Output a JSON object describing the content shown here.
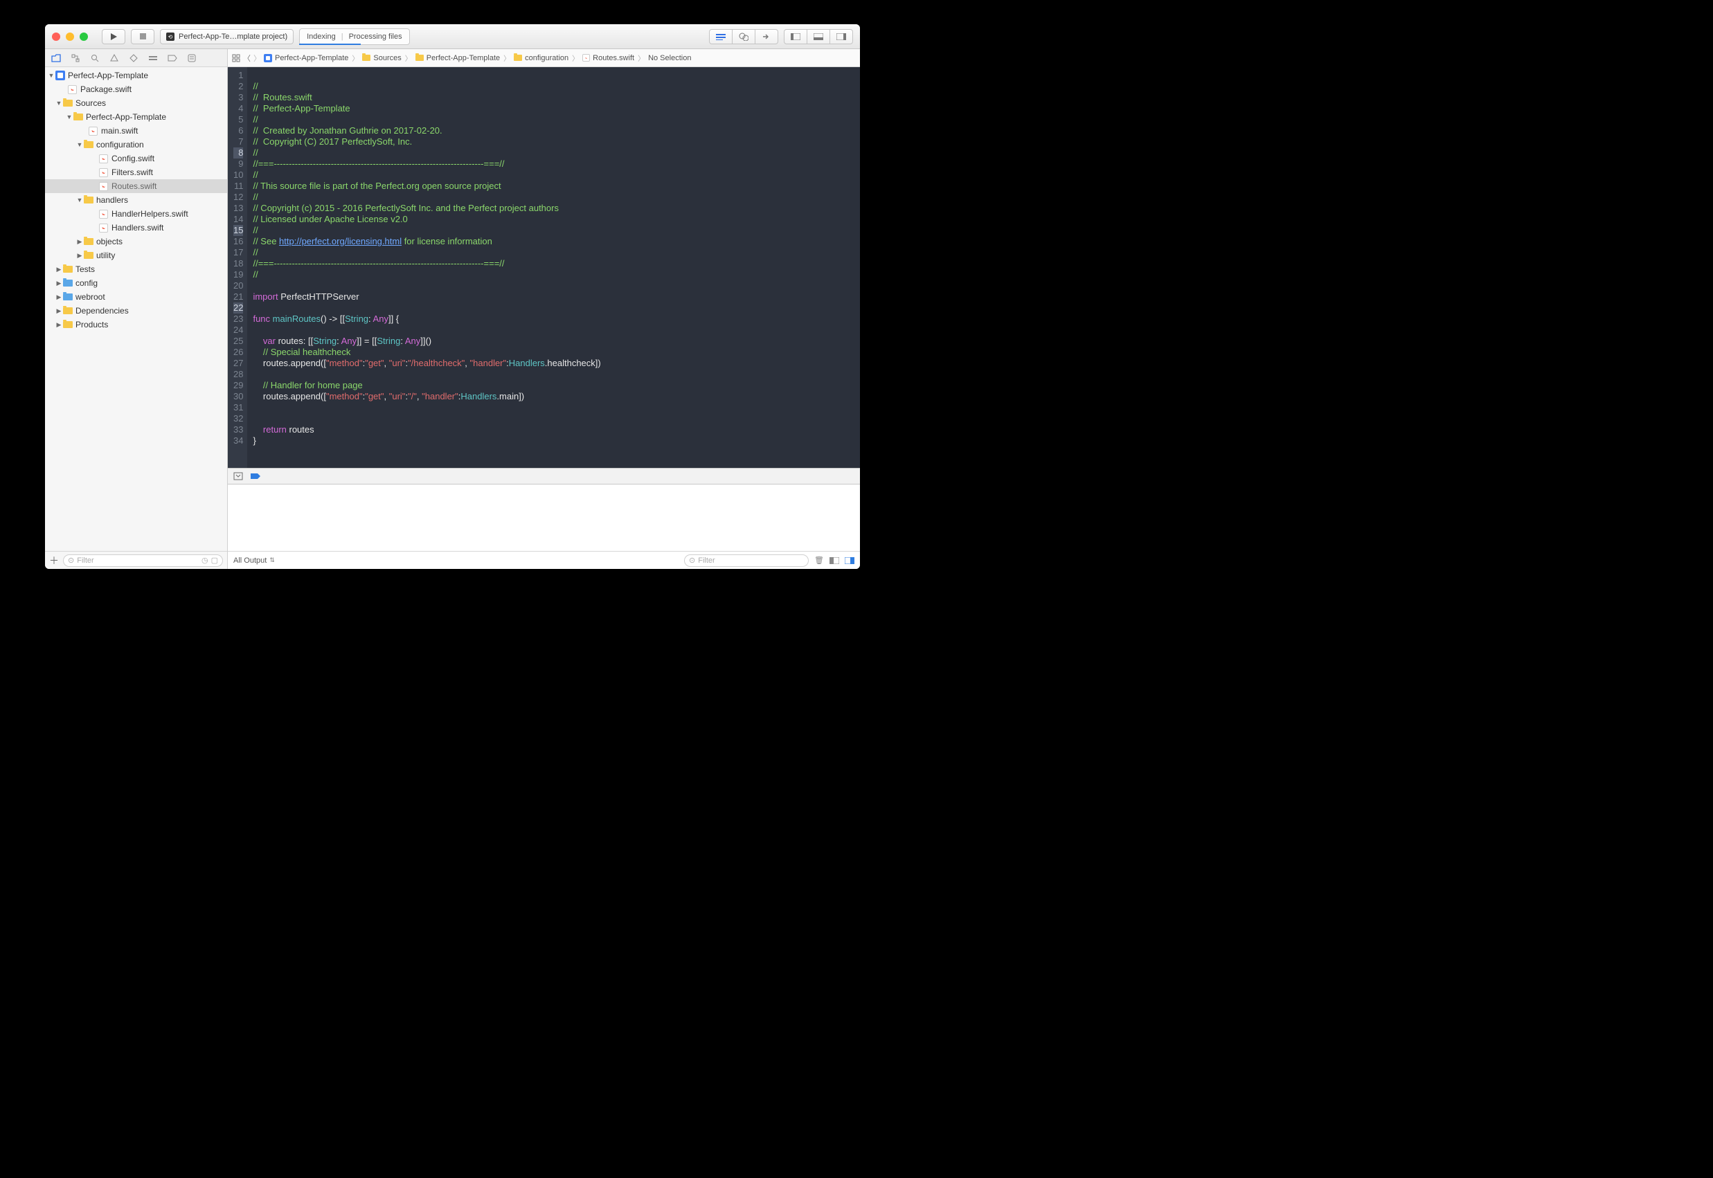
{
  "toolbar": {
    "scheme": "Perfect-App-Te…mplate project)",
    "activity_left": "Indexing",
    "activity_right": "Processing files"
  },
  "navigator": {
    "project": "Perfect-App-Template",
    "package": "Package.swift",
    "sources": "Sources",
    "app": "Perfect-App-Template",
    "main": "main.swift",
    "configuration": "configuration",
    "config": "Config.swift",
    "filters": "Filters.swift",
    "routes": "Routes.swift",
    "handlers": "handlers",
    "handlerhelpers": "HandlerHelpers.swift",
    "handlersfile": "Handlers.swift",
    "objects": "objects",
    "utility": "utility",
    "tests": "Tests",
    "configdir": "config",
    "webroot": "webroot",
    "dependencies": "Dependencies",
    "products": "Products",
    "filter_placeholder": "Filter"
  },
  "jumpbar": {
    "p0": "Perfect-App-Template",
    "p1": "Sources",
    "p2": "Perfect-App-Template",
    "p3": "configuration",
    "p4": "Routes.swift",
    "p5": "No Selection"
  },
  "code": {
    "lines": [
      "1",
      "2",
      "3",
      "4",
      "5",
      "6",
      "7",
      "8",
      "9",
      "10",
      "11",
      "12",
      "13",
      "14",
      "15",
      "16",
      "17",
      "18",
      "19",
      "20",
      "21",
      "22",
      "23",
      "24",
      "25",
      "26",
      "27",
      "28",
      "29",
      "30",
      "31",
      "32",
      "33",
      "34"
    ],
    "l1": "//",
    "l2a": "//  ",
    "l2b": "Routes.swift",
    "l3a": "//  ",
    "l3b": "Perfect-App-Template",
    "l4": "//",
    "l5": "//  Created by Jonathan Guthrie on 2017-02-20.",
    "l6": "//  Copyright (C) 2017 PerfectlySoft, Inc.",
    "l7": "//",
    "l8": "//===----------------------------------------------------------------------===//",
    "l9": "//",
    "l10": "// This source file is part of the Perfect.org open source project",
    "l11": "//",
    "l12": "// Copyright (c) 2015 - 2016 PerfectlySoft Inc. and the Perfect project authors",
    "l13": "// Licensed under Apache License v2.0",
    "l14": "//",
    "l15a": "// See ",
    "l15b": "http://perfect.org/licensing.html",
    "l15c": " for license information",
    "l16": "//",
    "l17": "//===----------------------------------------------------------------------===//",
    "l18": "//",
    "l20a": "import",
    "l20b": " PerfectHTTPServer",
    "l22a": "func",
    "l22b": " mainRoutes",
    "l22c": "() -> [[",
    "l22d": "String",
    "l22e": ": ",
    "l22f": "Any",
    "l22g": "]] {",
    "l24a": "    ",
    "l24b": "var",
    "l24c": " routes: [[",
    "l24d": "String",
    "l24e": ": ",
    "l24f": "Any",
    "l24g": "]] = [[",
    "l24h": "String",
    "l24i": ": ",
    "l24j": "Any",
    "l24k": "]]()",
    "l25": "    // Special healthcheck",
    "l26a": "    routes.append([",
    "l26b": "\"method\"",
    "l26c": ":",
    "l26d": "\"get\"",
    "l26e": ", ",
    "l26f": "\"uri\"",
    "l26g": ":",
    "l26h": "\"/healthcheck\"",
    "l26i": ", ",
    "l26j": "\"handler\"",
    "l26k": ":",
    "l26l": "Handlers",
    "l26m": ".healthcheck])",
    "l28": "    // Handler for home page",
    "l29a": "    routes.append([",
    "l29b": "\"method\"",
    "l29c": ":",
    "l29d": "\"get\"",
    "l29e": ", ",
    "l29f": "\"uri\"",
    "l29g": ":",
    "l29h": "\"/\"",
    "l29i": ", ",
    "l29j": "\"handler\"",
    "l29k": ":",
    "l29l": "Handlers",
    "l29m": ".main])",
    "l32a": "    ",
    "l32b": "return",
    "l32c": " routes",
    "l33": "}"
  },
  "console": {
    "output_label": "All Output",
    "filter_placeholder": "Filter"
  }
}
